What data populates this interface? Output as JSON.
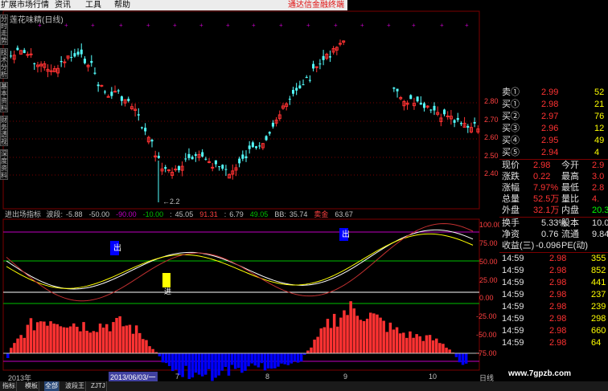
{
  "menu": {
    "items": [
      "扩展市场行情",
      "资讯",
      "工具",
      "帮助"
    ],
    "brand": "通达信金融终端"
  },
  "chart": {
    "title": "莲花味精(日线)",
    "low_marker": "2.2",
    "buy_label": "进",
    "sell_label": "出"
  },
  "side_tabs": [
    "分时走势",
    "技术分析",
    "基本资料",
    "财务透视",
    "深度资料"
  ],
  "price_axis": {
    "labels": [
      "2.80",
      "2.70",
      "2.60",
      "2.50",
      "2.40"
    ]
  },
  "indicator": {
    "name": "进出场指标",
    "fields": [
      {
        "label": "波段:",
        "value": "-5.88",
        "color": "#c0c0c0"
      },
      {
        "label": "",
        "value": "-50.00",
        "color": "#c0c0c0"
      },
      {
        "label": "",
        "value": "-90.00",
        "color": "#c000c0"
      },
      {
        "label": "",
        "value": "-10.00",
        "color": "#00c000"
      },
      {
        "label": ":",
        "value": "45.05",
        "color": "#c0c0c0"
      },
      {
        "label": "",
        "value": "91.31",
        "color": "#ff4040"
      },
      {
        "label": ":",
        "value": "6.79",
        "color": "#c0c0c0"
      },
      {
        "label": "",
        "value": "49.05",
        "color": "#00c000"
      },
      {
        "label": "BB:",
        "value": "35.74",
        "color": "#c0c0c0"
      },
      {
        "label": "",
        "value": "卖金",
        "color": "#ff4040"
      },
      {
        "label": "",
        "value": "63.67",
        "color": "#c0c0c0"
      }
    ]
  },
  "osc_axis": {
    "labels": [
      "100.00",
      "75.00",
      "50.00",
      "25.00",
      "0.00",
      "-25.00",
      "-50.00",
      "-75.00"
    ]
  },
  "timeline": {
    "labels": [
      "2013年",
      "2013/06/03/一",
      "7",
      "8",
      "9",
      "10",
      "日线"
    ]
  },
  "order_book": [
    {
      "label": "卖①",
      "price": "2.99",
      "vol": "52"
    },
    {
      "label": "买①",
      "price": "2.98",
      "vol": "21"
    },
    {
      "label": "买②",
      "price": "2.97",
      "vol": "76"
    },
    {
      "label": "买③",
      "price": "2.96",
      "vol": "12"
    },
    {
      "label": "买④",
      "price": "2.95",
      "vol": "49"
    },
    {
      "label": "买⑤",
      "price": "2.94",
      "vol": "4"
    }
  ],
  "stats": [
    {
      "l1": "现价",
      "v1": "2.98",
      "l2": "今开",
      "v2": "2.9"
    },
    {
      "l1": "涨跌",
      "v1": "0.22",
      "l2": "最高",
      "v2": "3.0"
    },
    {
      "l1": "涨幅",
      "v1": "7.97%",
      "l2": "最低",
      "v2": "2.8"
    },
    {
      "l1": "总量",
      "v1": "52.5万",
      "l2": "量比",
      "v2": "4."
    },
    {
      "l1": "外盘",
      "v1": "32.1万",
      "l2": "内盘",
      "v2": "20.3"
    }
  ],
  "stats2": [
    {
      "l1": "换手",
      "v1": "5.33%",
      "l2": "股本",
      "v2": "10.0"
    },
    {
      "l1": "净资",
      "v1": "0.76",
      "l2": "流通",
      "v2": "9.84"
    },
    {
      "l1": "收益(三)",
      "v1": "-0.096",
      "l2": "PE(动)",
      "v2": ""
    }
  ],
  "ticks": [
    {
      "time": "14:59",
      "price": "2.98",
      "vol": "355"
    },
    {
      "time": "14:59",
      "price": "2.98",
      "vol": "852"
    },
    {
      "time": "14:59",
      "price": "2.98",
      "vol": "441"
    },
    {
      "time": "14:59",
      "price": "2.98",
      "vol": "237"
    },
    {
      "time": "14:59",
      "price": "2.98",
      "vol": "239"
    },
    {
      "time": "14:59",
      "price": "2.98",
      "vol": "298"
    },
    {
      "time": "14:59",
      "price": "2.98",
      "vol": "660"
    },
    {
      "time": "14:59",
      "price": "2.98",
      "vol": "64"
    }
  ],
  "bottom_tabs": [
    "指标",
    "模板",
    "全部",
    "波段王",
    "ZJTJ"
  ],
  "watermark": "www.7gpzb.com",
  "colors": {
    "up": "#ff3232",
    "down": "#54ffff",
    "grid": "#7a0000",
    "yellow": "#ffff00",
    "green": "#00c000",
    "magenta": "#c000c0"
  }
}
